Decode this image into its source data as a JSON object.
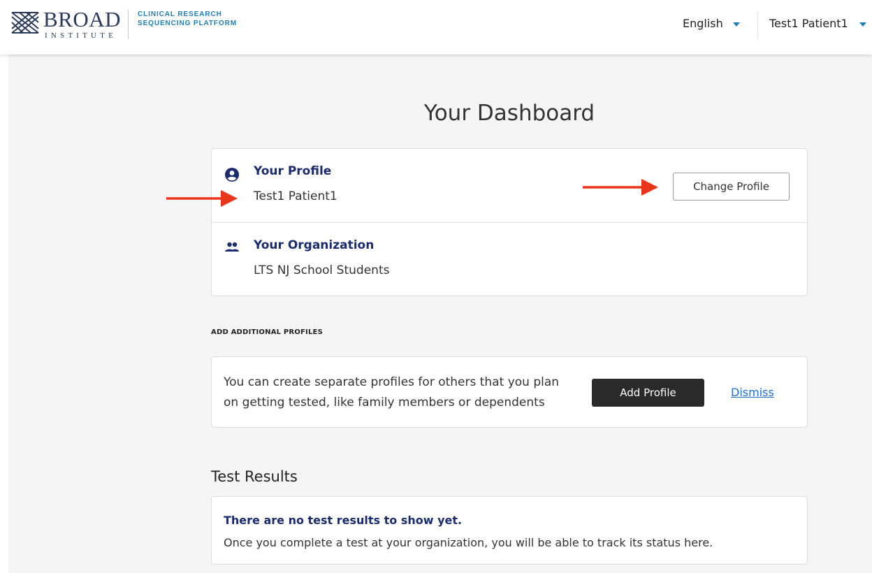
{
  "header": {
    "logo": {
      "word": "BROAD",
      "sub": "INSTITUTE",
      "tagline_line1": "CLINICAL RESEARCH",
      "tagline_line2": "SEQUENCING PLATFORM"
    },
    "language": "English",
    "user": "Test1 Patient1"
  },
  "dashboard": {
    "title": "Your Dashboard",
    "profile": {
      "label": "Your Profile",
      "value": "Test1 Patient1",
      "button": "Change Profile"
    },
    "organization": {
      "label": "Your Organization",
      "value": "LTS NJ School Students"
    }
  },
  "additional_profiles": {
    "section_label": "ADD ADDITIONAL PROFILES",
    "text_line1": "You can create separate profiles for others that you plan",
    "text_line2": "on getting tested, like family members or dependents",
    "add_button": "Add Profile",
    "dismiss_link": "Dismiss"
  },
  "test_results": {
    "title": "Test Results",
    "empty_title": "There are no test results to show yet.",
    "empty_text": "Once you complete a test at your organization, you will be able to track its status here."
  },
  "colors": {
    "accent": "#1f7fb5",
    "heading_blue": "#1a2b6e",
    "arrow_red": "#e8351c",
    "dark_button": "#2a2a2a",
    "link": "#1f6fd0"
  }
}
